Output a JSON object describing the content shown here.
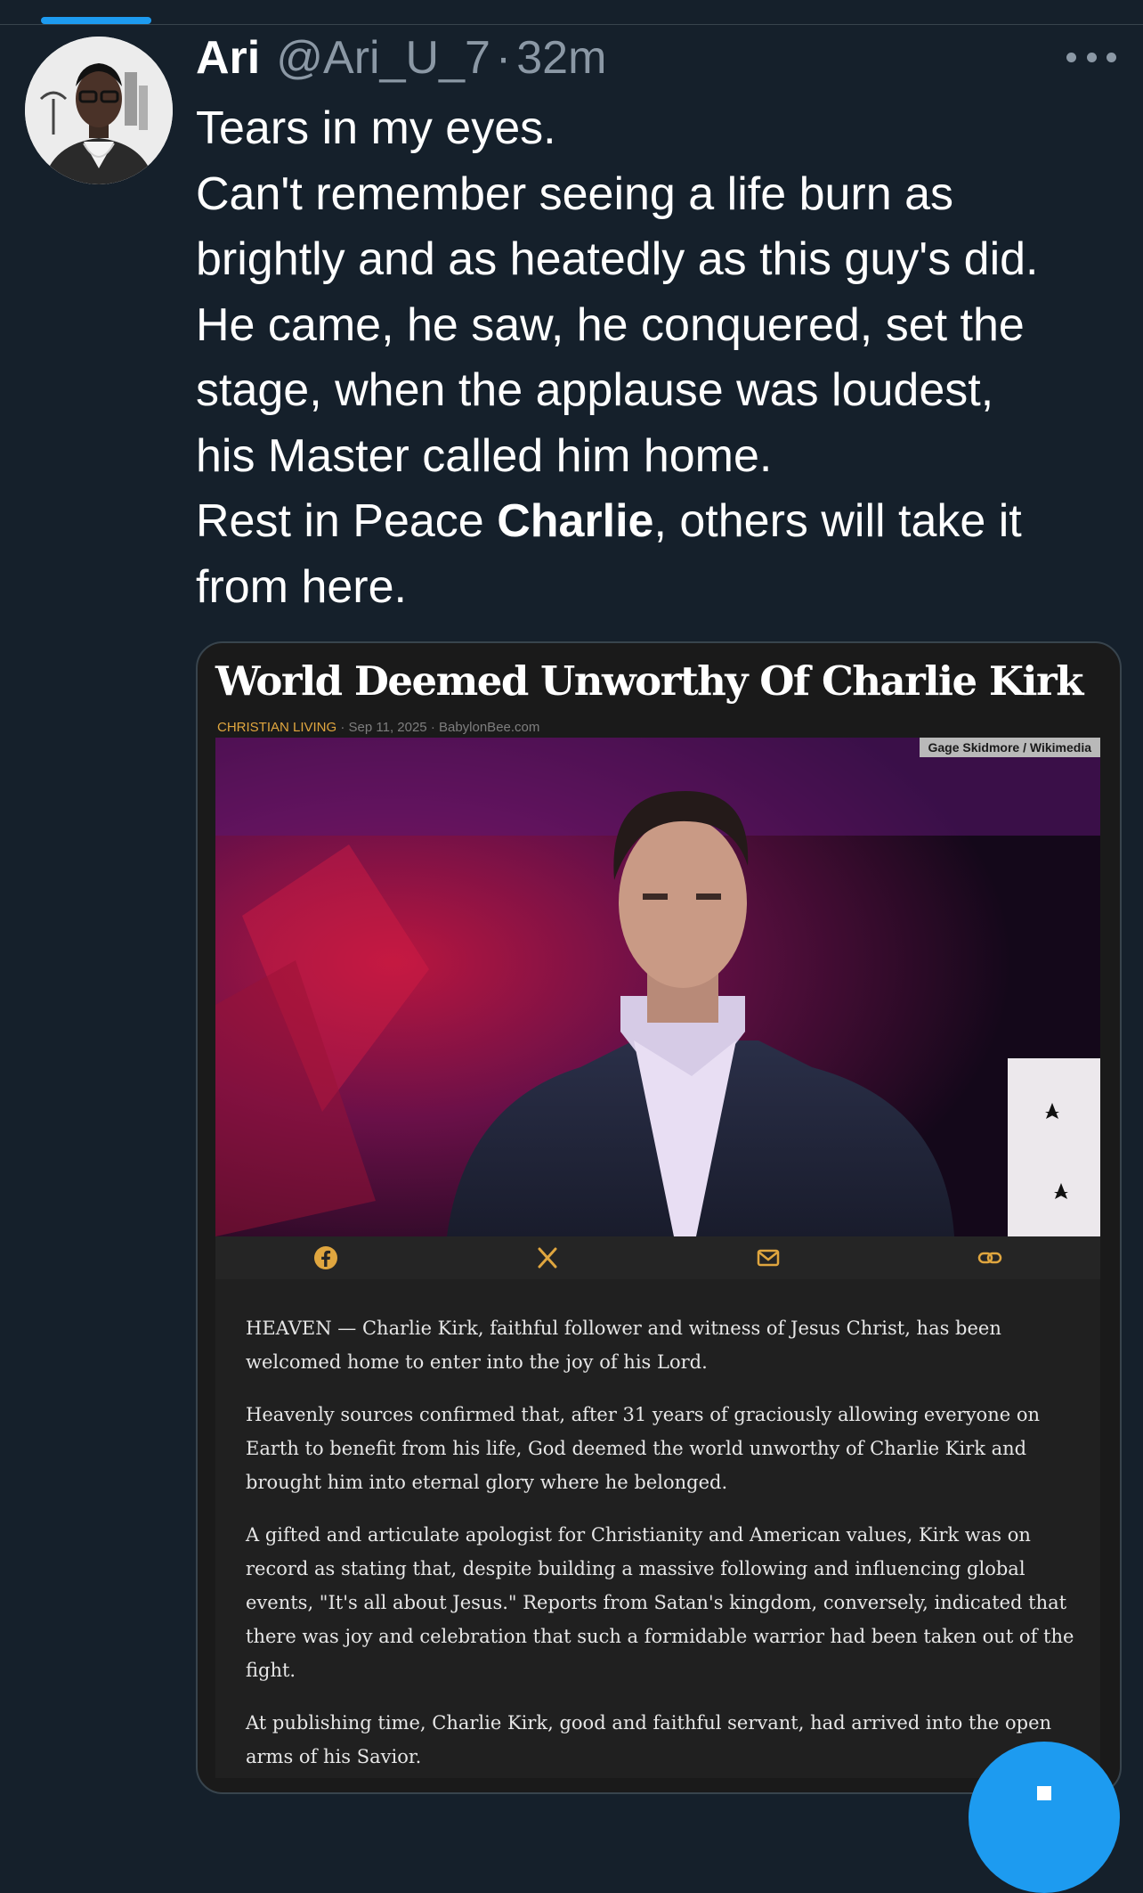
{
  "tweet": {
    "author": {
      "display_name": "Ari",
      "handle": "@Ari_U_7",
      "separator": "·",
      "time": "32m"
    },
    "text_lines": [
      {
        "text": "Tears in my eyes."
      },
      {
        "text": "Can't remember seeing a life burn as"
      },
      {
        "text": "brightly and as heatedly as this guy's did."
      },
      {
        "text": "He came, he saw, he conquered, set the"
      },
      {
        "text": "stage, when the applause was loudest,"
      },
      {
        "text": "his Master called him home."
      },
      {
        "before": "Rest in Peace ",
        "bold": "Charlie",
        "after": ", others will take it"
      },
      {
        "text": "from here."
      }
    ]
  },
  "card": {
    "headline": "World Deemed Unworthy Of Charlie Kirk",
    "category": "CHRISTIAN LIVING",
    "meta_rest": " · Sep 11, 2025 · BabylonBee.com",
    "photo_credit": "Gage Skidmore / Wikimedia",
    "share_icons": [
      "facebook-icon",
      "x-icon",
      "mail-icon",
      "link-icon"
    ],
    "share_color": "#e0a63f",
    "article_paragraphs": [
      [
        "HEAVEN — Charlie Kirk, faithful follower and witness of Jesus Christ, has been",
        "welcomed home to enter into the joy of his Lord."
      ],
      [
        "Heavenly sources confirmed that, after 31 years of graciously allowing everyone on",
        "Earth to benefit from his life, God deemed the world unworthy of Charlie Kirk and",
        "brought him into eternal glory where he belonged."
      ],
      [
        "A gifted and articulate apologist for Christianity and American values, Kirk was on",
        "record as stating that, despite building a massive following and influencing global",
        "events, \"It's all about Jesus.\" Reports from Satan's kingdom, conversely, indicated that",
        "there was joy and celebration that such a formidable warrior had been taken out of the",
        "fight."
      ],
      [
        "At publishing time, Charlie Kirk, good and faithful servant, had arrived into the open",
        "arms of his Savior."
      ]
    ]
  },
  "colors": {
    "background": "#15202b",
    "accent": "#1d9bf0",
    "muted": "#8b98a5"
  }
}
